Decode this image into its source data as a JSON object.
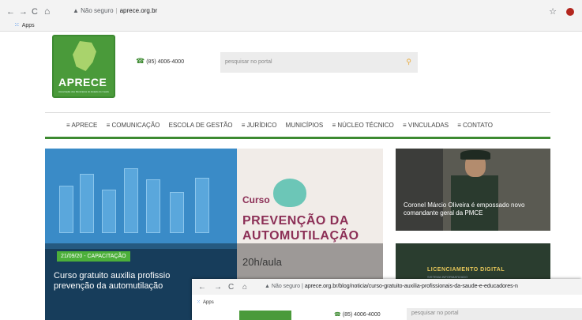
{
  "browser": {
    "back": "←",
    "forward": "→",
    "reload": "C",
    "home": "⌂",
    "security": "Não seguro",
    "url": "aprece.org.br",
    "apps": "Apps",
    "icons": {
      "star": "star-icon",
      "extension": "extension-icon"
    }
  },
  "header": {
    "logo_text": "APRECE",
    "logo_subtitle": "Associação dos Municípios do Estado do Ceará",
    "phone": "(85) 4006-4000",
    "search_placeholder": "pesquisar no portal"
  },
  "menu": [
    "≡ APRECE",
    "≡ COMUNICAÇÃO",
    "ESCOLA DE GESTÃO",
    "≡ JURÍDICO",
    "MUNICÍPIOS",
    "≡ NÚCLEO TÉCNICO",
    "≡ VINCULADAS",
    "≡ CONTATO"
  ],
  "hero": {
    "curso": "Curso",
    "headline_line1": "PREVENÇÃO DA",
    "headline_line2": "AUTOMUTILAÇÃO",
    "hours": "20h/aula",
    "badge": "21/09/20 - CAPACITAÇÃO",
    "title": "Curso gratuito auxilia profissio prevenção da automutilação"
  },
  "side_news": [
    {
      "title": "Coronel Márcio Oliveira é empossado novo comandante geral da PMCE"
    },
    {
      "title": "LICENCIAMENTO DIGITAL",
      "subtitle": "SISTEMA INFORMATIZADO"
    }
  ],
  "second_window": {
    "back": "←",
    "forward": "→",
    "reload": "C",
    "home": "⌂",
    "security": "Não seguro",
    "url": "aprece.org.br/blog/noticia/curso-gratuito-auxilia-profissionais-da-saude-e-educadores-n",
    "apps": "Apps",
    "phone": "(85) 4006-4000",
    "search_placeholder": "pesquisar no portal"
  },
  "colors": {
    "brand_green": "#3d8a31",
    "headline": "#8c2f56",
    "badge": "#4caf3a"
  }
}
